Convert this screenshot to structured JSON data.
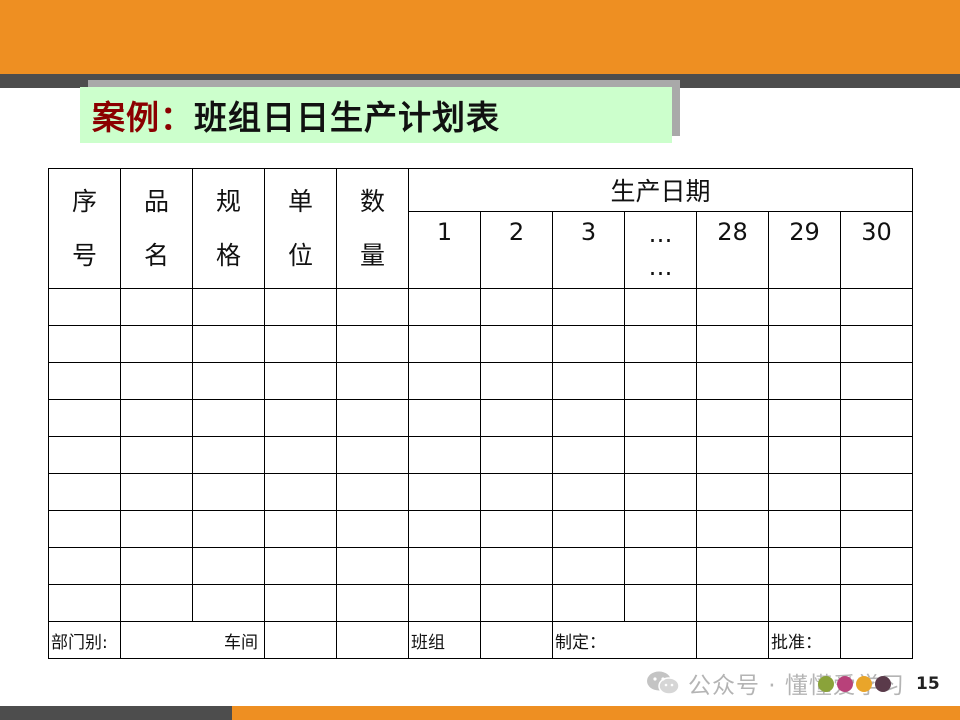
{
  "title": {
    "prefix": "案例：",
    "text": "班组日日生产计划表"
  },
  "table": {
    "left_headers": [
      {
        "top": "序",
        "bottom": "号"
      },
      {
        "top": "品",
        "bottom": "名"
      },
      {
        "top": "规",
        "bottom": "格"
      },
      {
        "top": "单",
        "bottom": "位"
      },
      {
        "top": "数",
        "bottom": "量"
      }
    ],
    "date_header": "生产日期",
    "days": [
      "1",
      "2",
      "3",
      "…",
      "28",
      "29",
      "30"
    ],
    "day_ellipsis": [
      "…",
      "…"
    ],
    "footer": {
      "dept_label": "部门别:",
      "workshop_label": "车间",
      "team_label": "班组",
      "made_label": "制定：",
      "approve_label": "批准："
    }
  },
  "watermark": "公众号 · 懂懂爱学习",
  "page_number": "15",
  "colors": {
    "accent_orange": "#ee8f22",
    "band_gray": "#4d4d4d",
    "title_bg": "#ccffcc",
    "title_prefix": "#8b0000",
    "dots": [
      "#8aa33a",
      "#b8417a",
      "#e9a52a",
      "#5a3a4a"
    ]
  }
}
